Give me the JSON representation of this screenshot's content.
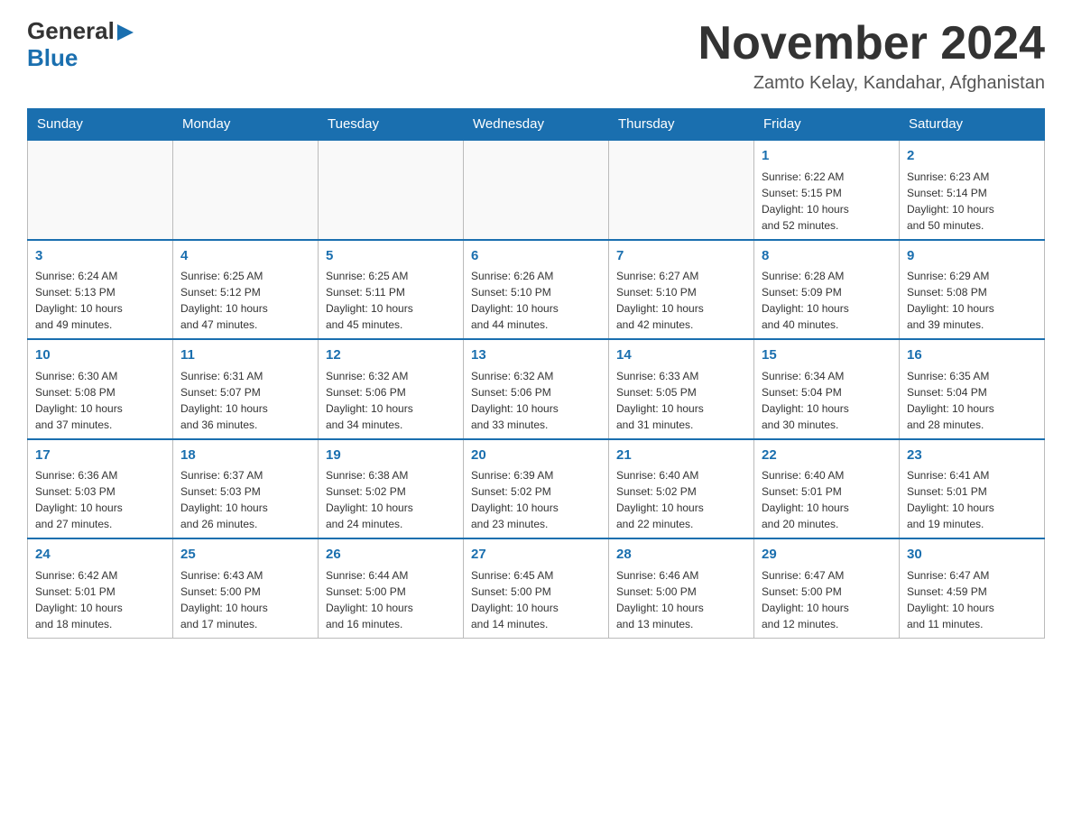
{
  "header": {
    "title": "November 2024",
    "subtitle": "Zamto Kelay, Kandahar, Afghanistan",
    "logo_general": "General",
    "logo_blue": "Blue"
  },
  "days_of_week": [
    "Sunday",
    "Monday",
    "Tuesday",
    "Wednesday",
    "Thursday",
    "Friday",
    "Saturday"
  ],
  "weeks": [
    {
      "days": [
        {
          "number": "",
          "info": ""
        },
        {
          "number": "",
          "info": ""
        },
        {
          "number": "",
          "info": ""
        },
        {
          "number": "",
          "info": ""
        },
        {
          "number": "",
          "info": ""
        },
        {
          "number": "1",
          "info": "Sunrise: 6:22 AM\nSunset: 5:15 PM\nDaylight: 10 hours\nand 52 minutes."
        },
        {
          "number": "2",
          "info": "Sunrise: 6:23 AM\nSunset: 5:14 PM\nDaylight: 10 hours\nand 50 minutes."
        }
      ]
    },
    {
      "days": [
        {
          "number": "3",
          "info": "Sunrise: 6:24 AM\nSunset: 5:13 PM\nDaylight: 10 hours\nand 49 minutes."
        },
        {
          "number": "4",
          "info": "Sunrise: 6:25 AM\nSunset: 5:12 PM\nDaylight: 10 hours\nand 47 minutes."
        },
        {
          "number": "5",
          "info": "Sunrise: 6:25 AM\nSunset: 5:11 PM\nDaylight: 10 hours\nand 45 minutes."
        },
        {
          "number": "6",
          "info": "Sunrise: 6:26 AM\nSunset: 5:10 PM\nDaylight: 10 hours\nand 44 minutes."
        },
        {
          "number": "7",
          "info": "Sunrise: 6:27 AM\nSunset: 5:10 PM\nDaylight: 10 hours\nand 42 minutes."
        },
        {
          "number": "8",
          "info": "Sunrise: 6:28 AM\nSunset: 5:09 PM\nDaylight: 10 hours\nand 40 minutes."
        },
        {
          "number": "9",
          "info": "Sunrise: 6:29 AM\nSunset: 5:08 PM\nDaylight: 10 hours\nand 39 minutes."
        }
      ]
    },
    {
      "days": [
        {
          "number": "10",
          "info": "Sunrise: 6:30 AM\nSunset: 5:08 PM\nDaylight: 10 hours\nand 37 minutes."
        },
        {
          "number": "11",
          "info": "Sunrise: 6:31 AM\nSunset: 5:07 PM\nDaylight: 10 hours\nand 36 minutes."
        },
        {
          "number": "12",
          "info": "Sunrise: 6:32 AM\nSunset: 5:06 PM\nDaylight: 10 hours\nand 34 minutes."
        },
        {
          "number": "13",
          "info": "Sunrise: 6:32 AM\nSunset: 5:06 PM\nDaylight: 10 hours\nand 33 minutes."
        },
        {
          "number": "14",
          "info": "Sunrise: 6:33 AM\nSunset: 5:05 PM\nDaylight: 10 hours\nand 31 minutes."
        },
        {
          "number": "15",
          "info": "Sunrise: 6:34 AM\nSunset: 5:04 PM\nDaylight: 10 hours\nand 30 minutes."
        },
        {
          "number": "16",
          "info": "Sunrise: 6:35 AM\nSunset: 5:04 PM\nDaylight: 10 hours\nand 28 minutes."
        }
      ]
    },
    {
      "days": [
        {
          "number": "17",
          "info": "Sunrise: 6:36 AM\nSunset: 5:03 PM\nDaylight: 10 hours\nand 27 minutes."
        },
        {
          "number": "18",
          "info": "Sunrise: 6:37 AM\nSunset: 5:03 PM\nDaylight: 10 hours\nand 26 minutes."
        },
        {
          "number": "19",
          "info": "Sunrise: 6:38 AM\nSunset: 5:02 PM\nDaylight: 10 hours\nand 24 minutes."
        },
        {
          "number": "20",
          "info": "Sunrise: 6:39 AM\nSunset: 5:02 PM\nDaylight: 10 hours\nand 23 minutes."
        },
        {
          "number": "21",
          "info": "Sunrise: 6:40 AM\nSunset: 5:02 PM\nDaylight: 10 hours\nand 22 minutes."
        },
        {
          "number": "22",
          "info": "Sunrise: 6:40 AM\nSunset: 5:01 PM\nDaylight: 10 hours\nand 20 minutes."
        },
        {
          "number": "23",
          "info": "Sunrise: 6:41 AM\nSunset: 5:01 PM\nDaylight: 10 hours\nand 19 minutes."
        }
      ]
    },
    {
      "days": [
        {
          "number": "24",
          "info": "Sunrise: 6:42 AM\nSunset: 5:01 PM\nDaylight: 10 hours\nand 18 minutes."
        },
        {
          "number": "25",
          "info": "Sunrise: 6:43 AM\nSunset: 5:00 PM\nDaylight: 10 hours\nand 17 minutes."
        },
        {
          "number": "26",
          "info": "Sunrise: 6:44 AM\nSunset: 5:00 PM\nDaylight: 10 hours\nand 16 minutes."
        },
        {
          "number": "27",
          "info": "Sunrise: 6:45 AM\nSunset: 5:00 PM\nDaylight: 10 hours\nand 14 minutes."
        },
        {
          "number": "28",
          "info": "Sunrise: 6:46 AM\nSunset: 5:00 PM\nDaylight: 10 hours\nand 13 minutes."
        },
        {
          "number": "29",
          "info": "Sunrise: 6:47 AM\nSunset: 5:00 PM\nDaylight: 10 hours\nand 12 minutes."
        },
        {
          "number": "30",
          "info": "Sunrise: 6:47 AM\nSunset: 4:59 PM\nDaylight: 10 hours\nand 11 minutes."
        }
      ]
    }
  ]
}
